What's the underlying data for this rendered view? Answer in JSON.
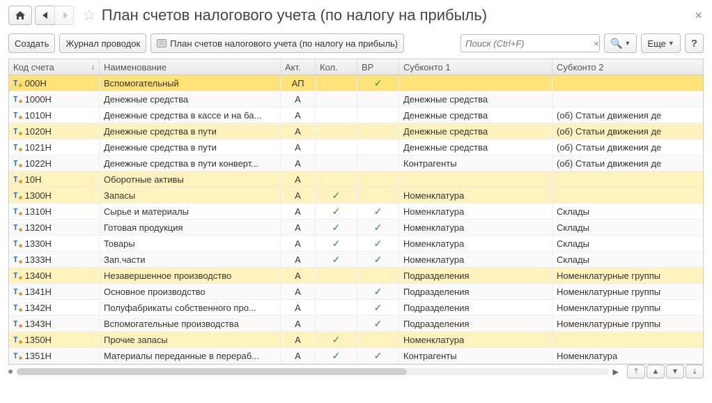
{
  "header": {
    "title": "План счетов налогового учета (по налогу на прибыль)"
  },
  "toolbar": {
    "create": "Создать",
    "journal": "Журнал проводок",
    "plan": "План счетов налогового учета (по налогу на прибыль)",
    "search_placeholder": "Поиск (Ctrl+F)",
    "more": "Еще",
    "help": "?"
  },
  "columns": {
    "code": "Код счета",
    "name": "Наименование",
    "akt": "Акт.",
    "kol": "Кол.",
    "bp": "ВР",
    "sub1": "Субконто 1",
    "sub2": "Субконто 2"
  },
  "rows": [
    {
      "code": "000Н",
      "name": "Вспомогательный",
      "akt": "АП",
      "kol": false,
      "bp": true,
      "sub1": "",
      "sub2": "",
      "hl": "sel"
    },
    {
      "code": "1000Н",
      "name": "Денежные средства",
      "akt": "А",
      "kol": false,
      "bp": false,
      "sub1": "Денежные средства",
      "sub2": "",
      "hl": ""
    },
    {
      "code": "1010Н",
      "name": "Денежные средства в кассе и на ба...",
      "akt": "А",
      "kol": false,
      "bp": false,
      "sub1": "Денежные средства",
      "sub2": "(об) Статьи движения де",
      "hl": ""
    },
    {
      "code": "1020Н",
      "name": "Денежные средства в пути",
      "akt": "А",
      "kol": false,
      "bp": false,
      "sub1": "Денежные средства",
      "sub2": "(об) Статьи движения де",
      "hl": "gold"
    },
    {
      "code": "1021Н",
      "name": "Денежные средства в пути",
      "akt": "А",
      "kol": false,
      "bp": false,
      "sub1": "Денежные средства",
      "sub2": "(об) Статьи движения де",
      "hl": ""
    },
    {
      "code": "1022Н",
      "name": "Денежные средства в пути конверт...",
      "akt": "А",
      "kol": false,
      "bp": false,
      "sub1": "Контрагенты",
      "sub2": "(об) Статьи движения де",
      "hl": ""
    },
    {
      "code": "10Н",
      "name": "Оборотные активы",
      "akt": "А",
      "kol": false,
      "bp": false,
      "sub1": "",
      "sub2": "",
      "hl": "gold"
    },
    {
      "code": "1300Н",
      "name": "Запасы",
      "akt": "А",
      "kol": true,
      "bp": false,
      "sub1": "Номенклатура",
      "sub2": "",
      "hl": "gold"
    },
    {
      "code": "1310Н",
      "name": "Сырье и материалы",
      "akt": "А",
      "kol": true,
      "bp": true,
      "sub1": "Номенклатура",
      "sub2": "Склады",
      "hl": ""
    },
    {
      "code": "1320Н",
      "name": "Готовая продукция",
      "akt": "А",
      "kol": true,
      "bp": true,
      "sub1": "Номенклатура",
      "sub2": "Склады",
      "hl": ""
    },
    {
      "code": "1330Н",
      "name": "Товары",
      "akt": "А",
      "kol": true,
      "bp": true,
      "sub1": "Номенклатура",
      "sub2": "Склады",
      "hl": ""
    },
    {
      "code": "1333Н",
      "name": "Зап.части",
      "akt": "А",
      "kol": true,
      "bp": true,
      "sub1": "Номенклатура",
      "sub2": "Склады",
      "hl": ""
    },
    {
      "code": "1340Н",
      "name": "Незавершенное производство",
      "akt": "А",
      "kol": false,
      "bp": false,
      "sub1": "Подразделения",
      "sub2": "Номенклатурные группы",
      "hl": "gold"
    },
    {
      "code": "1341Н",
      "name": "Основное производство",
      "akt": "А",
      "kol": false,
      "bp": true,
      "sub1": "Подразделения",
      "sub2": "Номенклатурные группы",
      "hl": ""
    },
    {
      "code": "1342Н",
      "name": "Полуфабрикаты собственного про...",
      "akt": "А",
      "kol": false,
      "bp": true,
      "sub1": "Подразделения",
      "sub2": "Номенклатурные группы",
      "hl": ""
    },
    {
      "code": "1343Н",
      "name": "Вспомогательные производства",
      "akt": "А",
      "kol": false,
      "bp": true,
      "sub1": "Подразделения",
      "sub2": "Номенклатурные группы",
      "hl": ""
    },
    {
      "code": "1350Н",
      "name": "Прочие запасы",
      "akt": "А",
      "kol": true,
      "bp": false,
      "sub1": "Номенклатура",
      "sub2": "",
      "hl": "gold"
    },
    {
      "code": "1351Н",
      "name": "Материалы переданные в перераб...",
      "akt": "А",
      "kol": true,
      "bp": true,
      "sub1": "Контрагенты",
      "sub2": "Номенклатура",
      "hl": ""
    }
  ]
}
